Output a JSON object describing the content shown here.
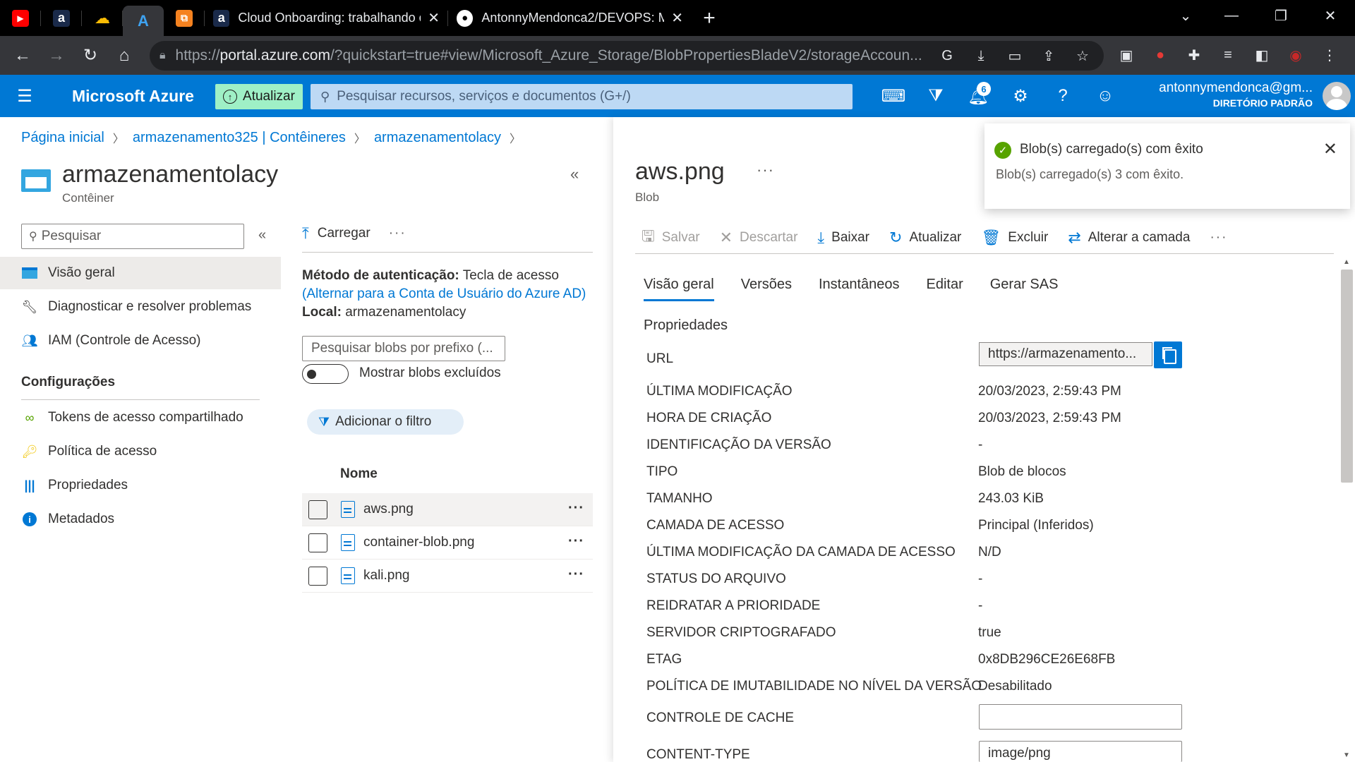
{
  "browser": {
    "pinned_tabs": [
      {
        "icon": "youtube-icon",
        "color": "#ff0000",
        "glyph": "▶"
      },
      {
        "icon": "app-a-icon",
        "color": "#1a2a4a",
        "glyph": "a"
      },
      {
        "icon": "google-cloud-icon",
        "color": "#000000",
        "glyph": "☁"
      },
      {
        "icon": "azure-icon",
        "color": "#0078d4",
        "glyph": "A"
      },
      {
        "icon": "orange-app-icon",
        "color": "#f58220",
        "glyph": "⧉"
      }
    ],
    "tabs": [
      {
        "title": "Cloud Onboarding: trabalhando c",
        "icon": "app-a-icon"
      },
      {
        "title": "AntonnyMendonca2/DEVOPS: M",
        "icon": "github-icon"
      }
    ],
    "url_prefix": "https://",
    "url_host": "portal.azure.com",
    "url_rest": "/?quickstart=true#view/Microsoft_Azure_Storage/BlobPropertiesBladeV2/storageAccoun..."
  },
  "azure": {
    "brand": "Microsoft Azure",
    "upgrade_label": "Atualizar",
    "search_placeholder": "Pesquisar recursos, serviços e documentos (G+/)",
    "notifications_count": "6",
    "account_email": "antonnymendonca@gm...",
    "account_directory": "DIRETÓRIO PADRÃO"
  },
  "breadcrumb": [
    "Página inicial",
    "armazenamento325 | Contêineres",
    "armazenamentolacy"
  ],
  "resource": {
    "title": "armazenamentolacy",
    "subtitle": "Contêiner",
    "search_placeholder": "Pesquisar",
    "nav": [
      {
        "label": "Visão geral",
        "icon": "overview-icon"
      },
      {
        "label": "Diagnosticar e resolver problemas",
        "icon": "wrench-icon"
      },
      {
        "label": "IAM (Controle de Acesso)",
        "icon": "people-icon"
      }
    ],
    "section": "Configurações",
    "settings_nav": [
      {
        "label": "Tokens de acesso compartilhado",
        "icon": "link-icon"
      },
      {
        "label": "Política de acesso",
        "icon": "key-icon"
      },
      {
        "label": "Propriedades",
        "icon": "properties-icon"
      },
      {
        "label": "Metadados",
        "icon": "info-icon"
      }
    ]
  },
  "container": {
    "upload_label": "Carregar",
    "auth_label": "Método de autenticação:",
    "auth_value": "Tecla de acesso",
    "auth_switch": "(Alternar para a Conta de Usuário do Azure AD)",
    "location_label": "Local:",
    "location_value": "armazenamentolacy",
    "prefix_placeholder": "Pesquisar blobs por prefixo (...",
    "show_deleted": "Mostrar blobs excluídos",
    "add_filter": "Adicionar o filtro",
    "column_name": "Nome",
    "blobs": [
      "aws.png",
      "container-blob.png",
      "kali.png"
    ]
  },
  "blob": {
    "title": "aws.png",
    "subtitle": "Blob",
    "toolbar": {
      "save": "Salvar",
      "discard": "Descartar",
      "download": "Baixar",
      "refresh": "Atualizar",
      "delete": "Excluir",
      "change_tier": "Alterar a camada"
    },
    "tabs": [
      "Visão geral",
      "Versões",
      "Instantâneos",
      "Editar",
      "Gerar SAS"
    ],
    "section": "Propriedades",
    "url_label": "URL",
    "url_value": "https://armazenamento...",
    "properties": [
      {
        "label": "ÚLTIMA MODIFICAÇÃO",
        "value": "20/03/2023, 2:59:43 PM"
      },
      {
        "label": "HORA DE CRIAÇÃO",
        "value": "20/03/2023, 2:59:43 PM"
      },
      {
        "label": "IDENTIFICAÇÃO DA VERSÃO",
        "value": "-"
      },
      {
        "label": "TIPO",
        "value": "Blob de blocos"
      },
      {
        "label": "TAMANHO",
        "value": "243.03 KiB"
      },
      {
        "label": "CAMADA DE ACESSO",
        "value": "Principal (Inferidos)"
      },
      {
        "label": "ÚLTIMA MODIFICAÇÃO DA CAMADA DE ACESSO",
        "value": "N/D"
      },
      {
        "label": "STATUS DO ARQUIVO",
        "value": "-"
      },
      {
        "label": "REIDRATAR A PRIORIDADE",
        "value": "-"
      },
      {
        "label": "SERVIDOR CRIPTOGRAFADO",
        "value": "true"
      },
      {
        "label": "ETAG",
        "value": "0x8DB296CE26E68FB"
      },
      {
        "label": "POLÍTICA DE IMUTABILIDADE NO NÍVEL DA VERSÃO",
        "value": "Desabilitado"
      }
    ],
    "cache_label": "CONTROLE DE CACHE",
    "cache_value": "",
    "content_type_label": "CONTENT-TYPE",
    "content_type_value": "image/png"
  },
  "toast": {
    "title": "Blob(s) carregado(s) com êxito",
    "message": "Blob(s) carregado(s) 3 com êxito."
  }
}
